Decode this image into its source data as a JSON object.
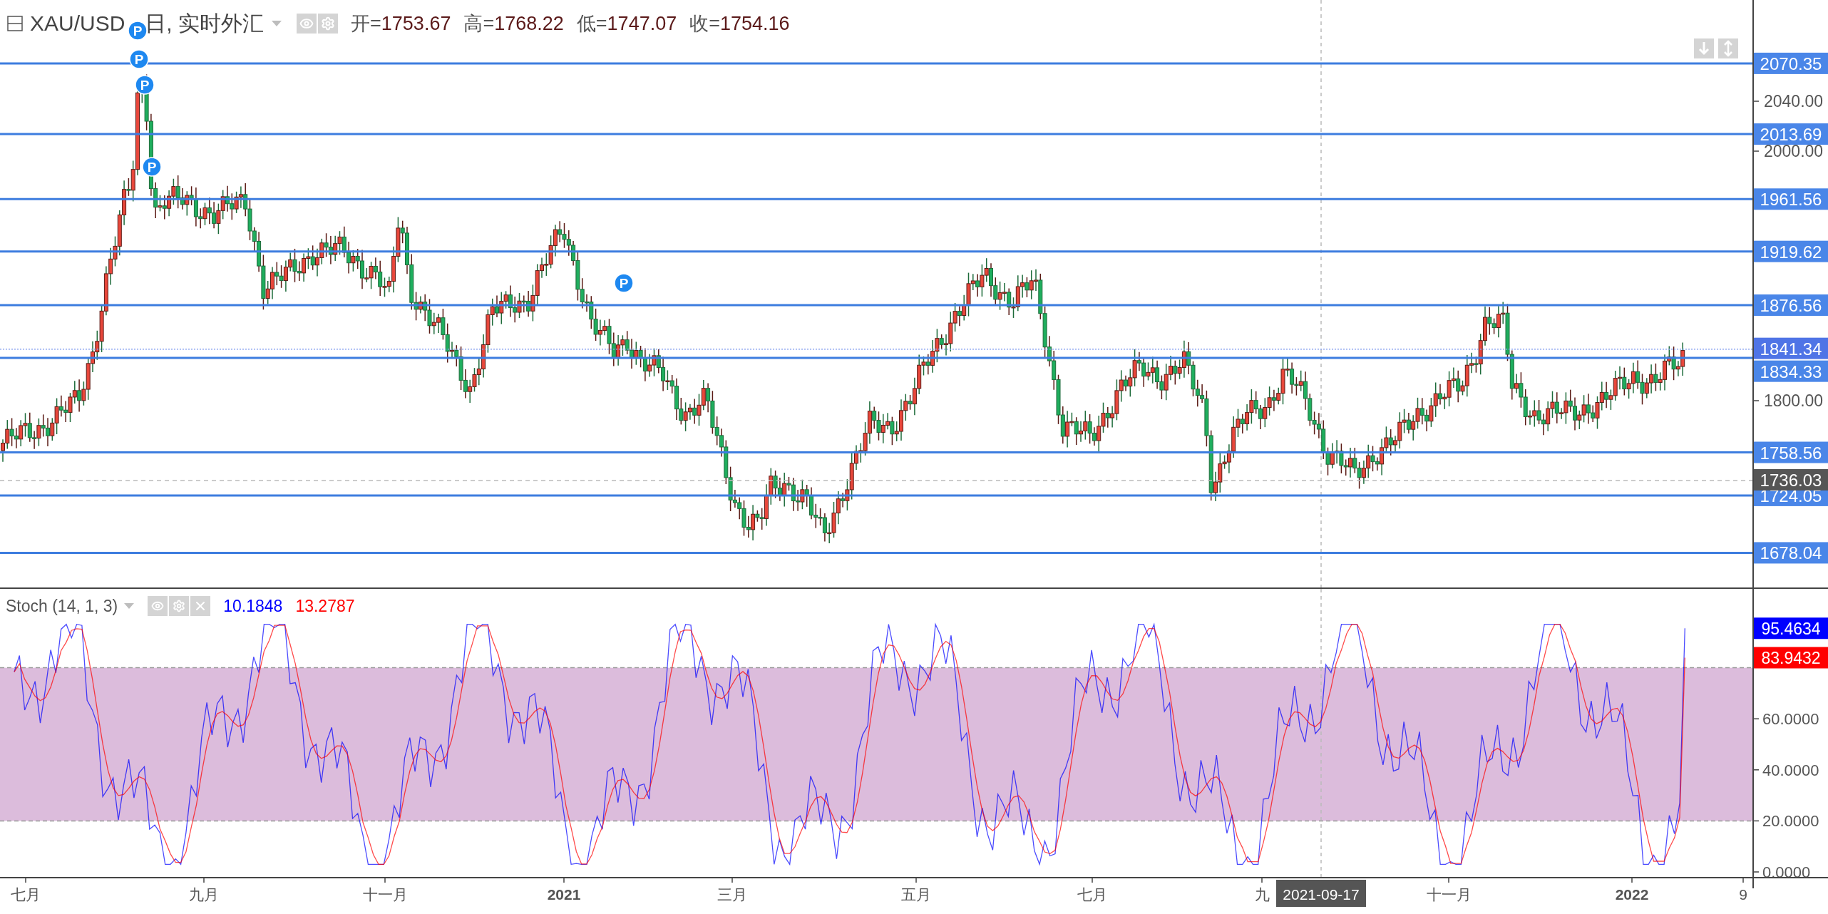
{
  "header": {
    "symbol": "XAU/USD",
    "interval": "日, 实时外汇",
    "ohlc": [
      {
        "label": "开=",
        "value": "1753.67"
      },
      {
        "label": "高=",
        "value": "1768.22"
      },
      {
        "label": "低=",
        "value": "1747.07"
      },
      {
        "label": "收=",
        "value": "1754.16"
      }
    ]
  },
  "price_panel": {
    "axis_ticks": [
      "2040.00",
      "2000.00",
      "1800.00"
    ],
    "levels": [
      {
        "label": "2070.35"
      },
      {
        "label": "2013.69"
      },
      {
        "label": "1961.56"
      },
      {
        "label": "1919.62"
      },
      {
        "label": "1876.56"
      },
      {
        "label": "1834.33"
      },
      {
        "label": "1758.56"
      },
      {
        "label": "1724.05"
      },
      {
        "label": "1678.04"
      }
    ],
    "last_price": "1841.34",
    "crosshair_price": "1736.03",
    "markers": [
      "P",
      "P",
      "P",
      "P",
      "P"
    ]
  },
  "stoch_panel": {
    "title": "Stoch (14, 1, 3)",
    "values": [
      {
        "text": "10.1848",
        "color": "#0000ff"
      },
      {
        "text": "13.2787",
        "color": "#ff0000"
      }
    ],
    "axis_ticks": [
      "60.0000",
      "40.0000",
      "20.0000",
      "0.0000"
    ],
    "labels": [
      {
        "text": "95.4634",
        "color": "#0000ff"
      },
      {
        "text": "83.9432",
        "color": "#ff0000"
      }
    ]
  },
  "time_axis": {
    "labels": [
      {
        "text": "七月",
        "bold": false
      },
      {
        "text": "九月",
        "bold": false
      },
      {
        "text": "十一月",
        "bold": false
      },
      {
        "text": "2021",
        "bold": true
      },
      {
        "text": "三月",
        "bold": false
      },
      {
        "text": "五月",
        "bold": false
      },
      {
        "text": "七月",
        "bold": false
      },
      {
        "text": "九",
        "bold": false
      },
      {
        "text": "十一月",
        "bold": false
      },
      {
        "text": "2022",
        "bold": true
      },
      {
        "text": "9",
        "bold": false
      }
    ],
    "crosshair_date": "2021-09-17"
  }
}
